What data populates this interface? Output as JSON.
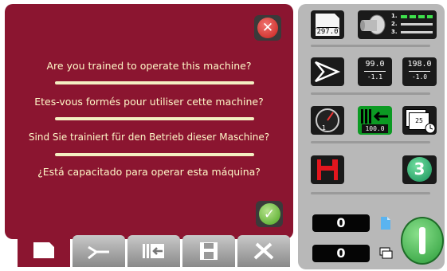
{
  "dialog": {
    "questions": [
      "Are you trained to operate this machine?",
      "Etes-vous formés pour utiliser cette machine?",
      "Sind Sie trainiert für den Betrieb dieser Maschine?",
      "¿Está capacitado para operar esta máquina?"
    ],
    "close_icon": "close-icon",
    "confirm_icon": "checkmark-icon"
  },
  "tabs": [
    {
      "icon": "sheet-icon",
      "active": true
    },
    {
      "icon": "pattern-icon",
      "active": false
    },
    {
      "icon": "feed-icon",
      "active": false
    },
    {
      "icon": "save-icon",
      "active": false
    },
    {
      "icon": "tools-icon",
      "active": false
    }
  ],
  "right_panel": {
    "sheet_length": "297.0",
    "job_steps": [
      "1.",
      "2.",
      "3."
    ],
    "left_offset": {
      "value": "99.0",
      "delta": "-1.1"
    },
    "right_offset": {
      "value": "198.0",
      "delta": "-1.0"
    },
    "feed_position": "100.0",
    "stack_count": "25",
    "mode_number": "3",
    "counter_sheets": "0",
    "counter_batches": "0"
  },
  "colors": {
    "dialog_background": "#8b1530",
    "panel_background": "#b8b8b8",
    "text_color": "#fff8c8",
    "accent_green": "#2c9d3a",
    "feed_green": "#0c9a23"
  }
}
